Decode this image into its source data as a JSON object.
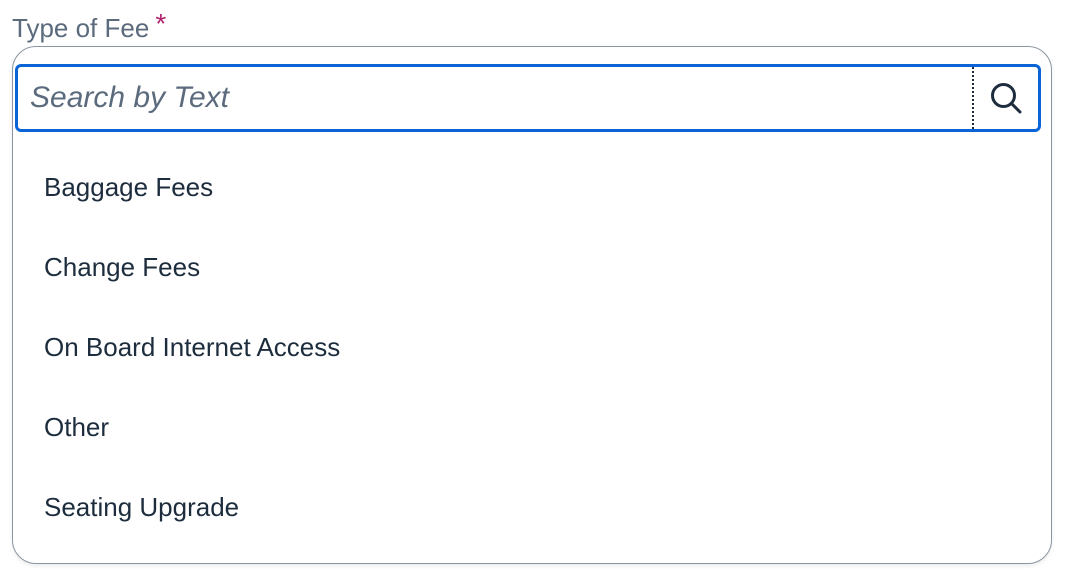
{
  "field": {
    "label": "Type of Fee",
    "required_marker": "*"
  },
  "search": {
    "placeholder": "Search by Text",
    "value": "",
    "icon": "search-icon"
  },
  "options": [
    "Baggage Fees",
    "Change Fees",
    "On Board Internet Access",
    "Other",
    "Seating Upgrade"
  ],
  "colors": {
    "accent": "#0a64d6",
    "required": "#b0246f",
    "label": "#5b6b7d",
    "text": "#1d2d3e"
  }
}
